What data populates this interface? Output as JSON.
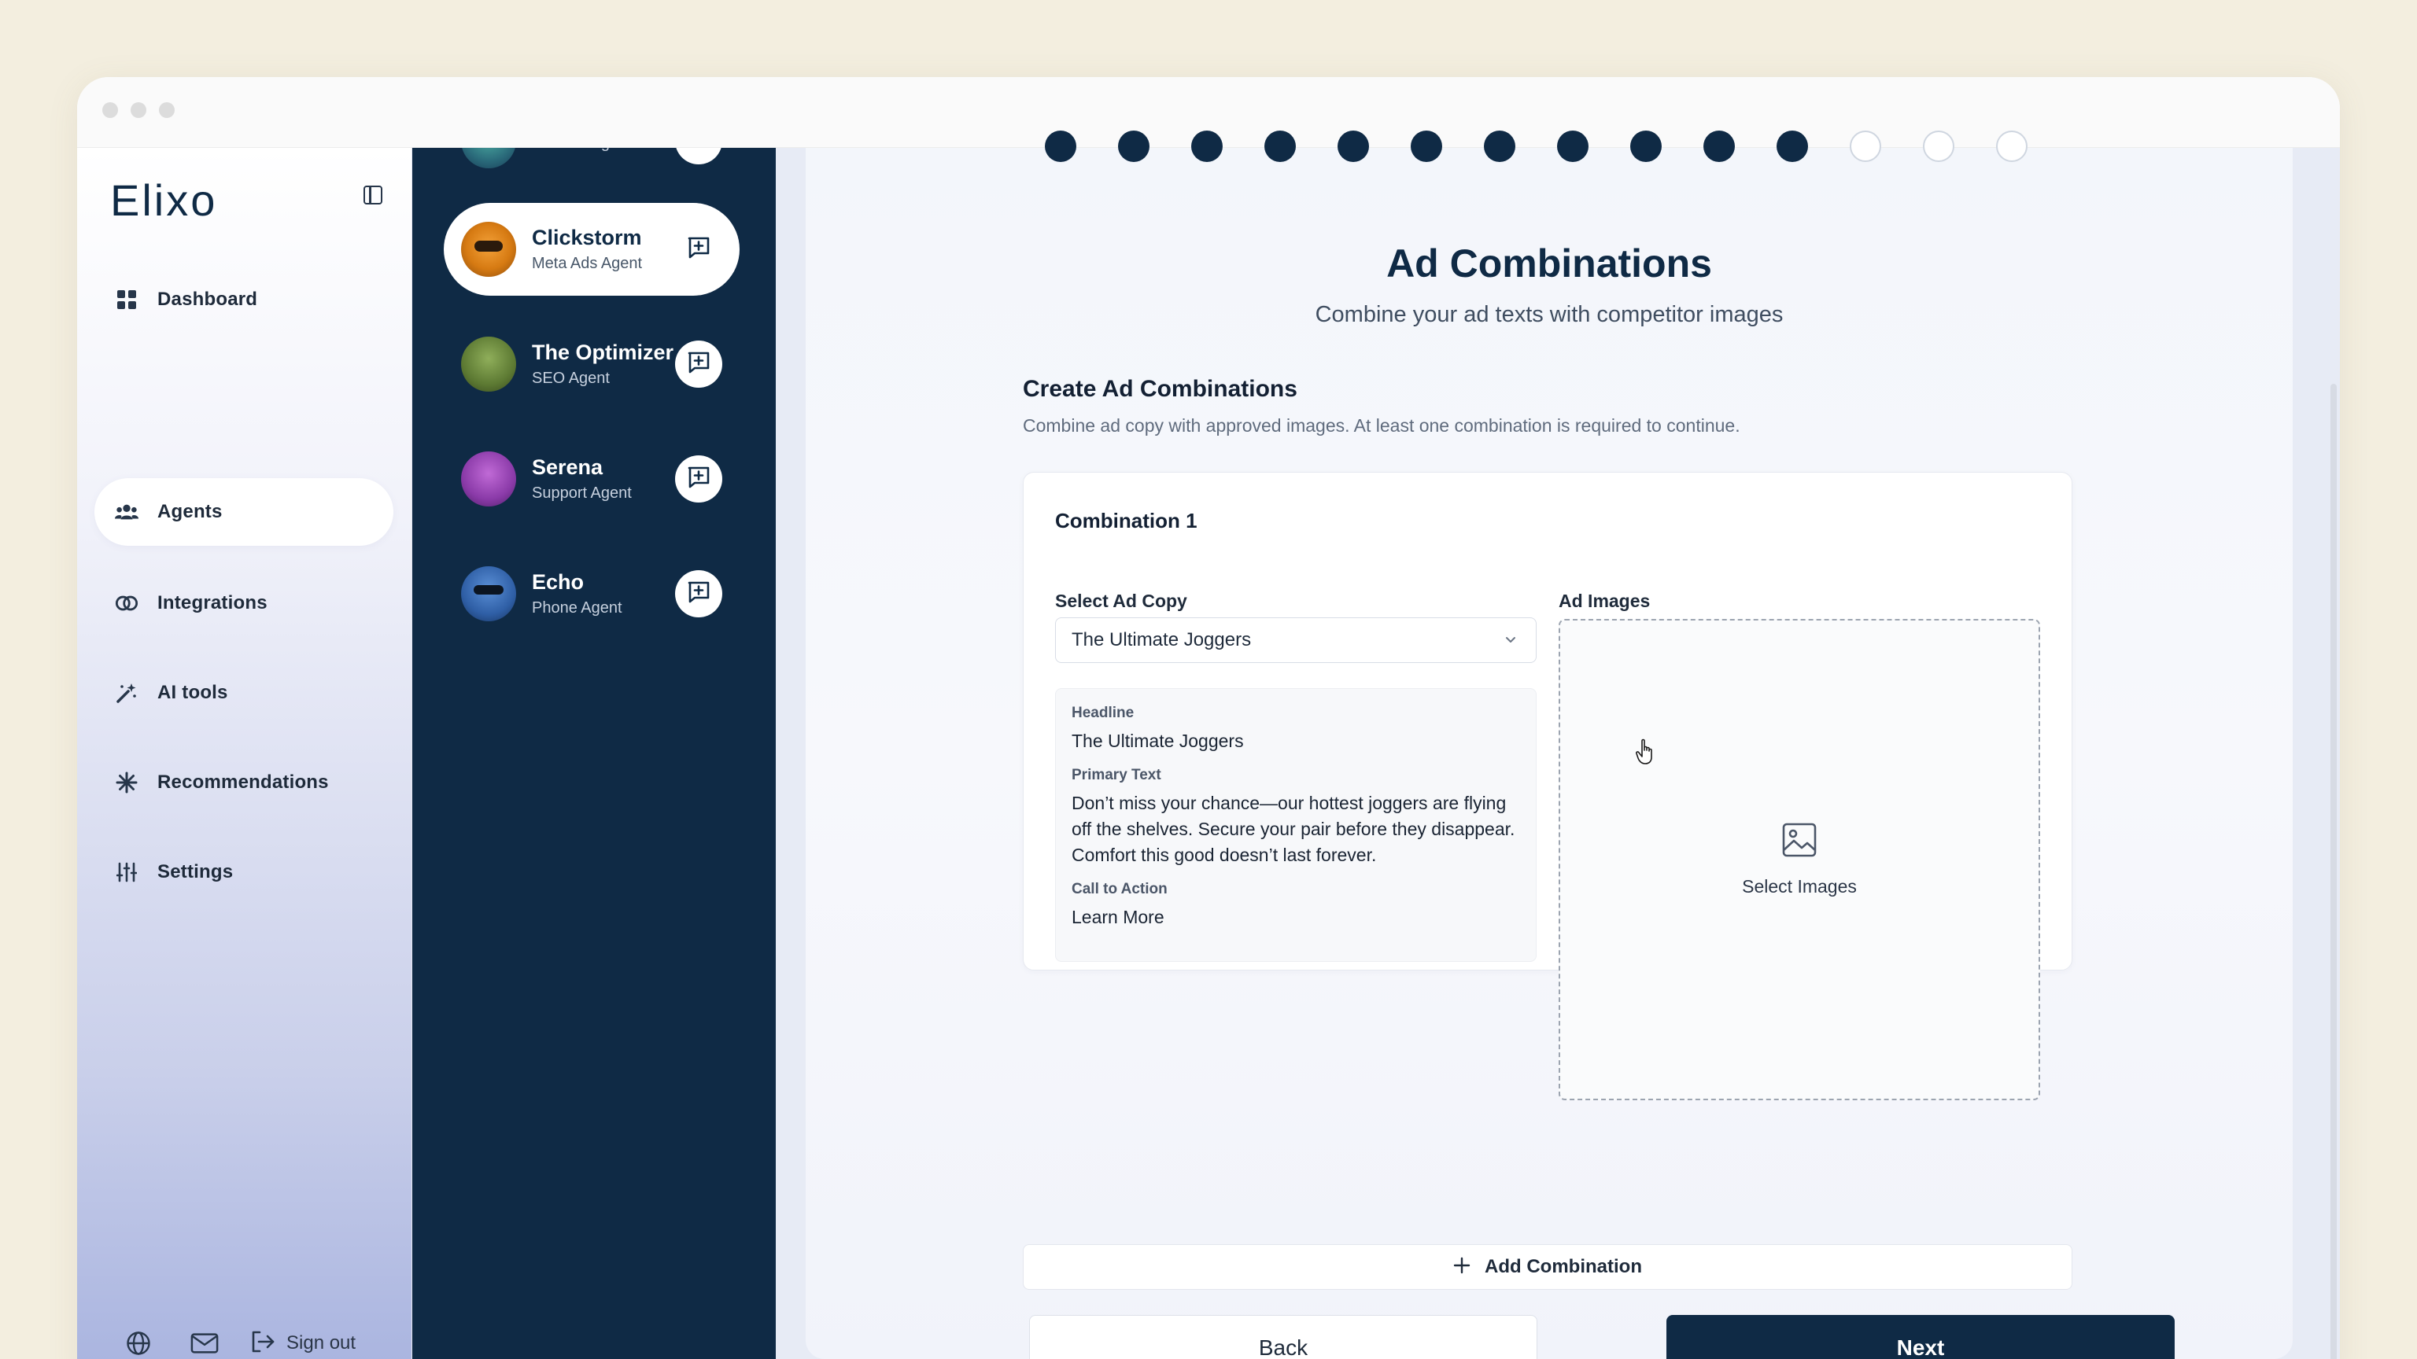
{
  "app": {
    "logo": "Elixo"
  },
  "sidebar": {
    "items": [
      {
        "label": "Dashboard",
        "icon": "grid-icon",
        "active": false
      },
      {
        "label": "Agents",
        "icon": "users-icon",
        "active": true
      },
      {
        "label": "Integrations",
        "icon": "link-circles-icon",
        "active": false
      },
      {
        "label": "AI tools",
        "icon": "magic-wand-icon",
        "active": false
      },
      {
        "label": "Recommendations",
        "icon": "sparkle-icon",
        "active": false
      },
      {
        "label": "Settings",
        "icon": "sliders-icon",
        "active": false
      }
    ],
    "footer": {
      "signout_label": "Sign out"
    }
  },
  "agents": [
    {
      "name": "",
      "role": "Content Agent",
      "active": false
    },
    {
      "name": "Clickstorm",
      "role": "Meta Ads Agent",
      "active": true
    },
    {
      "name": "The Optimizer",
      "role": "SEO Agent",
      "active": false
    },
    {
      "name": "Serena",
      "role": "Support Agent",
      "active": false
    },
    {
      "name": "Echo",
      "role": "Phone Agent",
      "active": false
    }
  ],
  "stepper": {
    "total_steps": 14,
    "completed_steps": 11
  },
  "page": {
    "title": "Ad Combinations",
    "subtitle": "Combine your ad texts with competitor images",
    "section_title": "Create Ad Combinations",
    "section_desc": "Combine ad copy with approved images. At least one combination is required to continue."
  },
  "combination": {
    "title": "Combination 1",
    "select_label": "Select Ad Copy",
    "selected_copy": "The Ultimate Joggers",
    "preview": {
      "headline_label": "Headline",
      "headline": "The Ultimate Joggers",
      "primary_label": "Primary Text",
      "primary_text": "Don’t miss your chance—our hottest joggers are flying off the shelves. Secure your pair before they disappear. Comfort this good doesn’t last forever.",
      "cta_label": "Call to Action",
      "cta": "Learn More"
    },
    "images_label": "Ad Images",
    "select_images_label": "Select Images"
  },
  "actions": {
    "add_combination": "Add Combination",
    "back": "Back",
    "next": "Next"
  },
  "colors": {
    "navy": "#0f2a45",
    "page_bg": "#f3eedf"
  }
}
